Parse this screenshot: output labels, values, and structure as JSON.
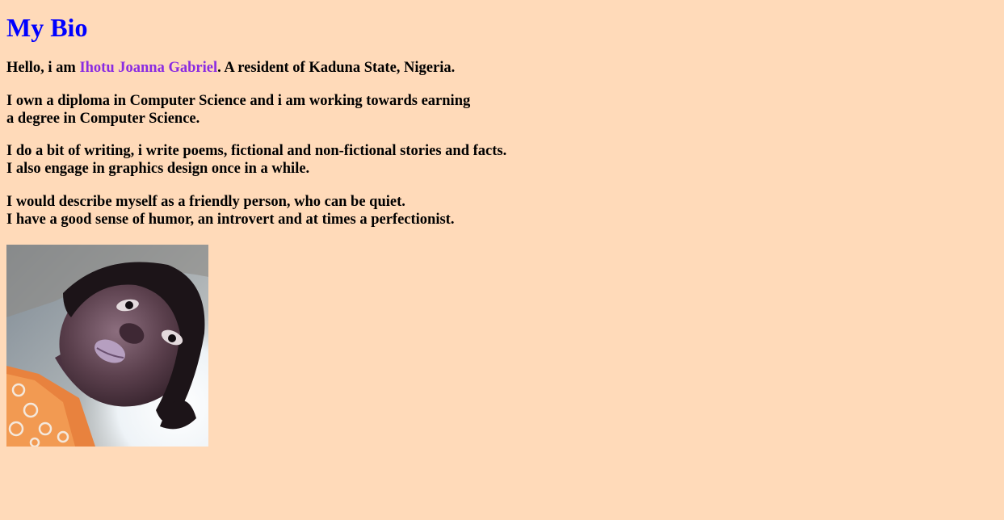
{
  "page": {
    "title": "My Bio",
    "colors": {
      "background": "#FFDAB9",
      "title": "#0000FF",
      "name_highlight": "#8A2BE2",
      "text": "#000000"
    }
  },
  "intro": {
    "prefix": "Hello, i am ",
    "name": "Ihotu Joanna Gabriel",
    "suffix": ". A resident of Kaduna State, Nigeria."
  },
  "education": {
    "line1": "I own a diploma in Computer Science and i am working towards earning",
    "line2": "a degree in Computer Science."
  },
  "hobbies": {
    "line1": "I do a bit of writing, i write poems, fictional and non-fictional stories and facts.",
    "line2": "I also engage in graphics design once in a while."
  },
  "personality": {
    "line1": "I would describe myself as a friendly person, who can be quiet.",
    "line2": "I have a good sense of humor, an introvert and at times a perfectionist."
  },
  "photo": {
    "icon": "portrait-photo"
  }
}
